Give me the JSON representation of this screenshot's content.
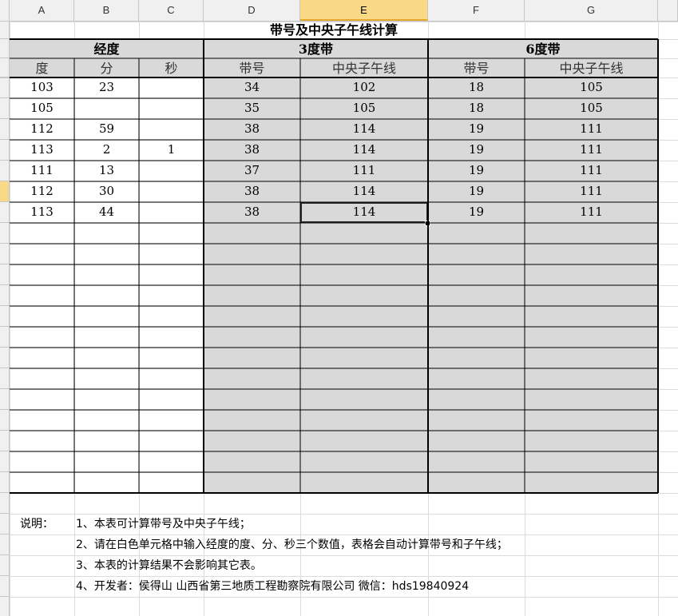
{
  "columns": [
    "A",
    "B",
    "C",
    "D",
    "E",
    "F",
    "G"
  ],
  "active_column": "E",
  "title": "带号及中央子午线计算",
  "groups": {
    "longitude": "经度",
    "band3": "3度带",
    "band6": "6度带"
  },
  "subheaders": {
    "deg": "度",
    "min": "分",
    "sec": "秒",
    "band3_zone": "带号",
    "band3_meridian": "中央子午线",
    "band6_zone": "带号",
    "band6_meridian": "中央子午线"
  },
  "rows": [
    {
      "deg": "103",
      "min": "23",
      "sec": "",
      "z3": "34",
      "m3": "102",
      "z6": "18",
      "m6": "105"
    },
    {
      "deg": "105",
      "min": "",
      "sec": "",
      "z3": "35",
      "m3": "105",
      "z6": "18",
      "m6": "105"
    },
    {
      "deg": "112",
      "min": "59",
      "sec": "",
      "z3": "38",
      "m3": "114",
      "z6": "19",
      "m6": "111"
    },
    {
      "deg": "113",
      "min": "2",
      "sec": "1",
      "z3": "38",
      "m3": "114",
      "z6": "19",
      "m6": "111"
    },
    {
      "deg": "111",
      "min": "13",
      "sec": "",
      "z3": "37",
      "m3": "111",
      "z6": "19",
      "m6": "111"
    },
    {
      "deg": "112",
      "min": "30",
      "sec": "",
      "z3": "38",
      "m3": "114",
      "z6": "19",
      "m6": "111"
    },
    {
      "deg": "113",
      "min": "44",
      "sec": "",
      "z3": "38",
      "m3": "114",
      "z6": "19",
      "m6": "111"
    }
  ],
  "empty_rows": 13,
  "notes": {
    "label": "说明：",
    "lines": [
      "1、本表可计算带号及中央子午线；",
      "2、请在白色单元格中输入经度的度、分、秒三个数值，表格会自动计算带号和子午线；",
      "3、本表的计算结果不会影响其它表。",
      "4、开发者：侯得山  山西省第三地质工程勘察院有限公司  微信：hds19840924"
    ]
  }
}
